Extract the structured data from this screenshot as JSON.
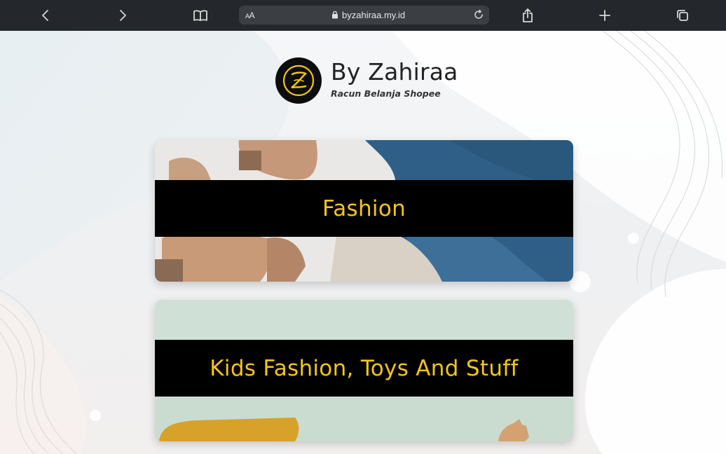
{
  "browser": {
    "text_size_label": "AA",
    "url": "byzahiraa.my.id",
    "icons": [
      "back-icon",
      "forward-icon",
      "bookmarks-icon",
      "lock-icon",
      "reload-icon",
      "share-icon",
      "new-tab-icon",
      "tabs-icon"
    ]
  },
  "brand": {
    "title": "By Zahiraa",
    "subtitle": "Racun Belanja Shopee",
    "accent_color": "#f5c518"
  },
  "categories": [
    {
      "label": "Fashion"
    },
    {
      "label": "Kids Fashion, Toys And Stuff"
    }
  ]
}
